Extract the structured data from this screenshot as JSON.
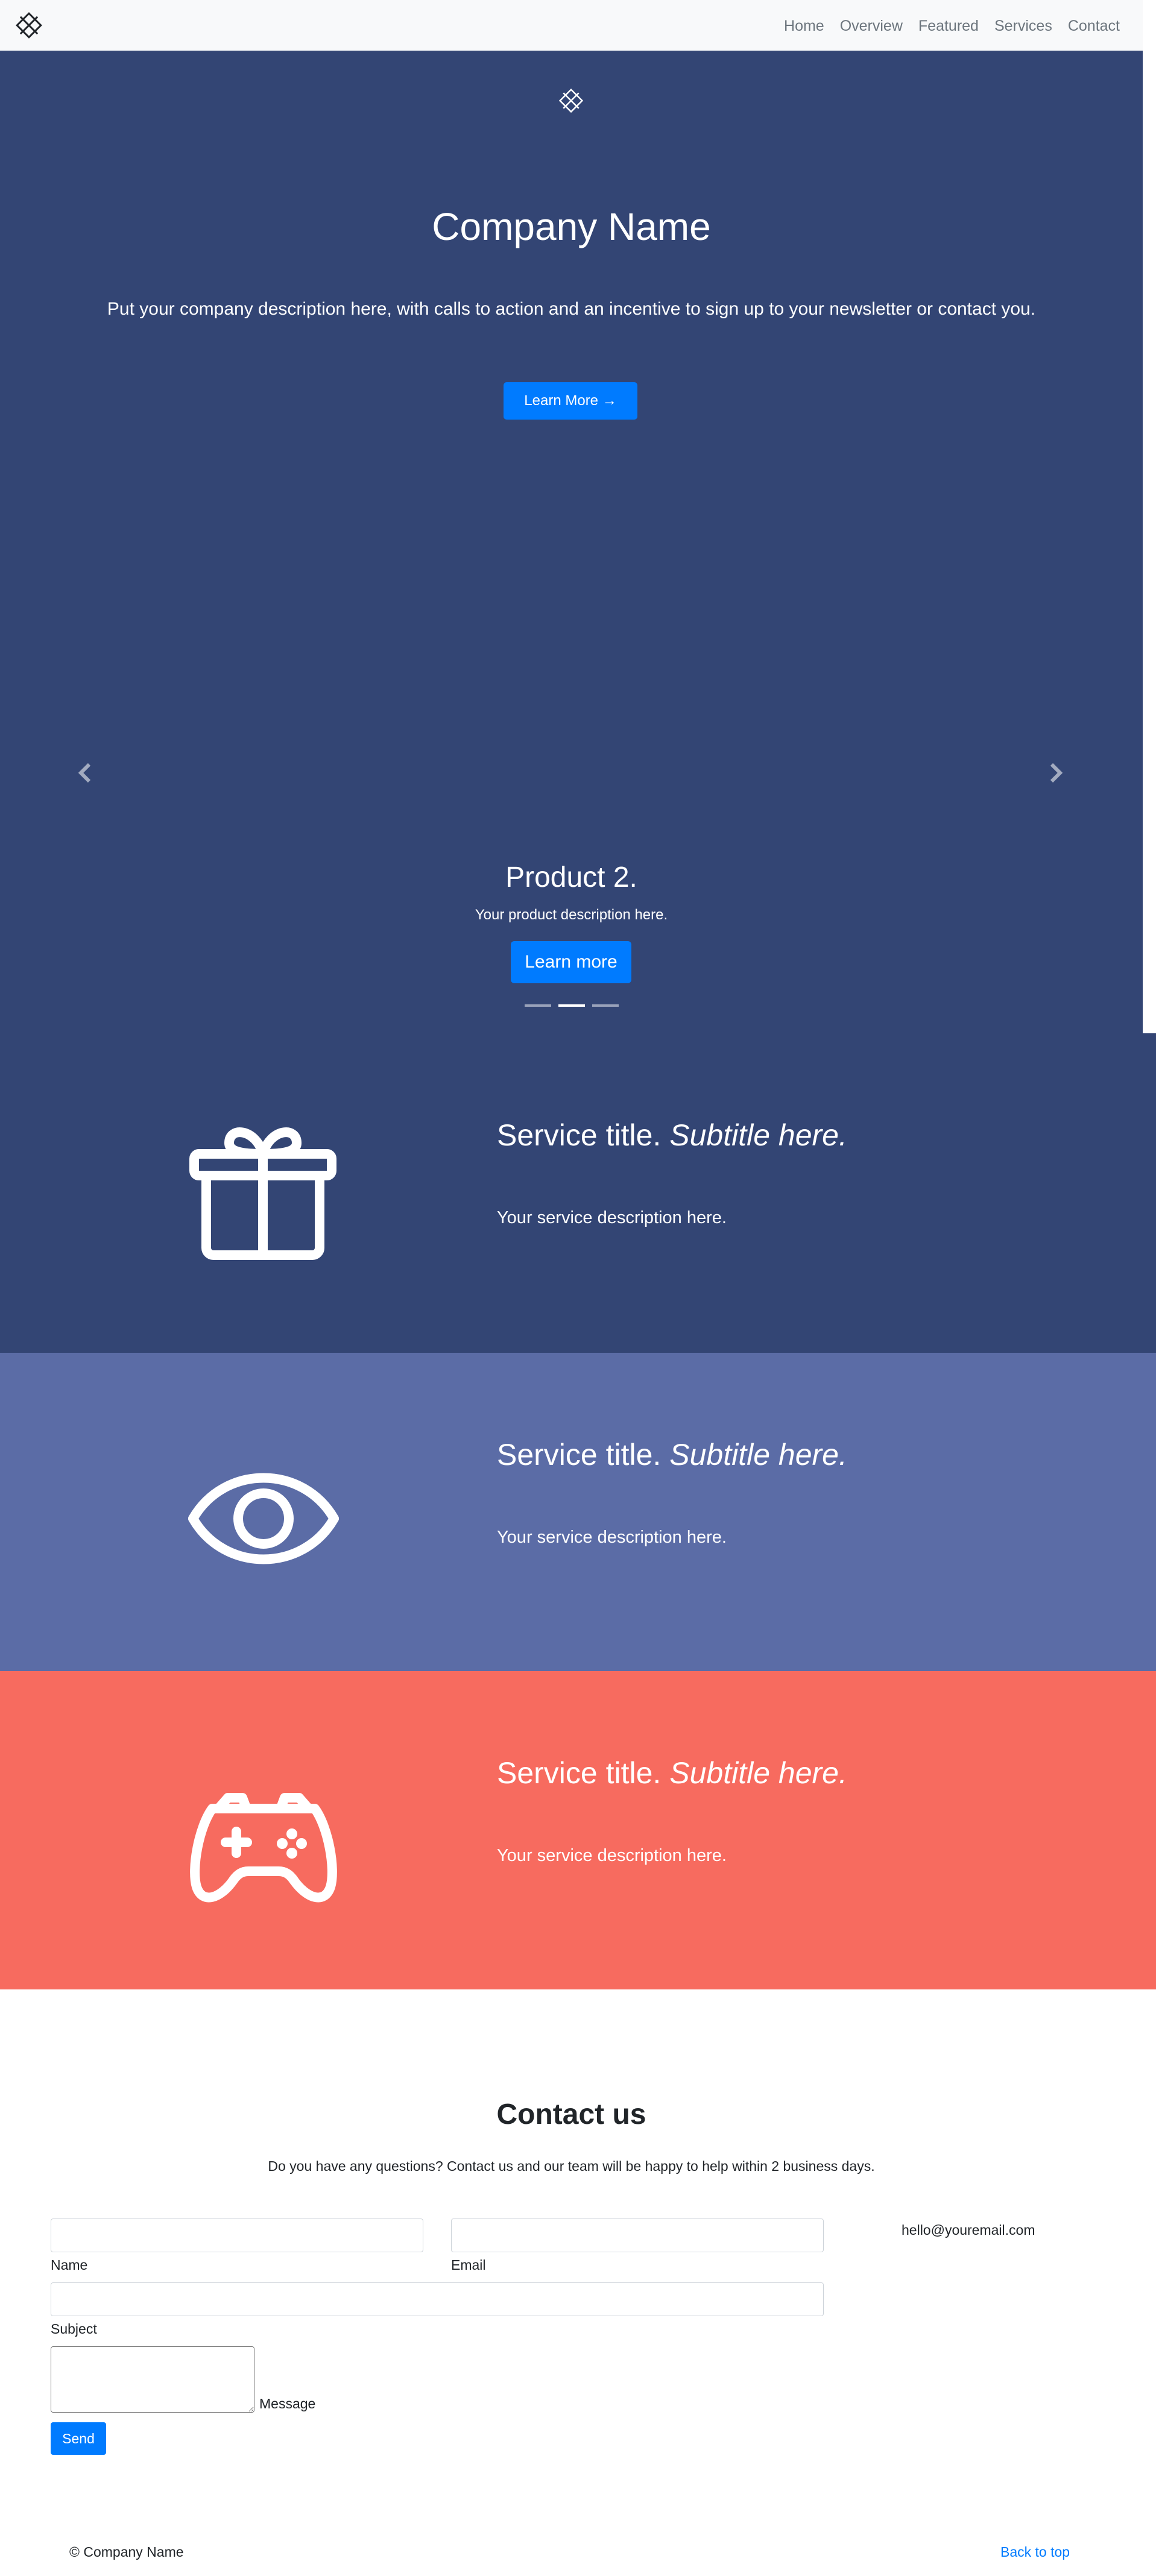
{
  "nav": {
    "logo_icon": "diamond-grid-logo",
    "links": [
      "Home",
      "Overview",
      "Featured",
      "Services",
      "Contact"
    ]
  },
  "hero": {
    "logo_icon": "diamond-grid-logo",
    "title": "Company Name",
    "description": "Put your company description here, with calls to action and an incentive to sign up to your newsletter or contact you.",
    "button_label": "Learn More →"
  },
  "carousel": {
    "slide_title": "Product 2.",
    "slide_description": "Your product description here.",
    "slide_button": "Learn more",
    "indicator_count": 3,
    "active_index": 1,
    "prev_icon": "chevron-left-icon",
    "next_icon": "chevron-right-icon"
  },
  "services": [
    {
      "icon": "gift-icon",
      "title": "Service title.",
      "subtitle": "Subtitle here.",
      "description": "Your service description here.",
      "bg_color": "#334574"
    },
    {
      "icon": "eye-icon",
      "title": "Service title.",
      "subtitle": "Subtitle here.",
      "description": "Your service description here.",
      "bg_color": "#5b6ca6"
    },
    {
      "icon": "gamepad-icon",
      "title": "Service title.",
      "subtitle": "Subtitle here.",
      "description": "Your service description here.",
      "bg_color": "#f76b5f"
    }
  ],
  "contact": {
    "title": "Contact us",
    "subtitle": "Do you have any questions? Contact us and our team will be happy to help within 2 business days.",
    "name_label": "Name",
    "email_label": "Email",
    "subject_label": "Subject",
    "message_label": "Message",
    "send_label": "Send",
    "email_address": "hello@youremail.com"
  },
  "footer": {
    "copyright": "© Company Name",
    "back_to_top": "Back to top"
  },
  "colors": {
    "primary": "#007bff",
    "hero_bg": "#334574",
    "nav_bg": "#f8f9fa"
  }
}
